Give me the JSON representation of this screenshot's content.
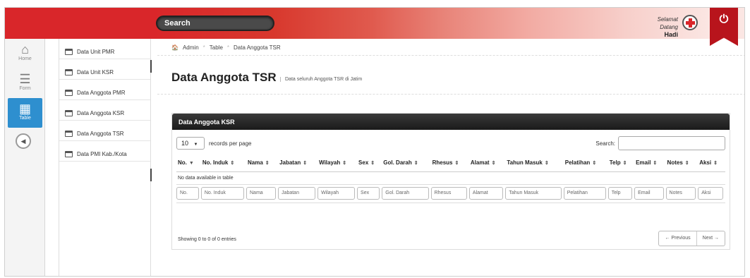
{
  "header": {
    "search_label": "Search",
    "welcome_line1": "Selamat Datang",
    "welcome_user": "Hadi",
    "power_icon": "power-icon",
    "accent_color": "#d9262a"
  },
  "rail": {
    "items": [
      {
        "label": "Home",
        "icon": "home-icon",
        "glyph": "⌂"
      },
      {
        "label": "Form",
        "icon": "list-icon",
        "glyph": "☰"
      },
      {
        "label": "Table",
        "icon": "table-icon",
        "glyph": "▦"
      }
    ],
    "collapse_glyph": "◀"
  },
  "submenu": {
    "items": [
      {
        "label": "Data Unit PMR"
      },
      {
        "label": "Data Unit KSR"
      },
      {
        "label": "Data Anggota PMR"
      },
      {
        "label": "Data Anggota KSR"
      },
      {
        "label": "Data Anggota TSR"
      },
      {
        "label": "Data PMI Kab./Kota"
      }
    ]
  },
  "breadcrumb": {
    "items": [
      "Admin",
      "Table",
      "Data Anggota TSR"
    ],
    "separator": "*"
  },
  "page": {
    "title": "Data Anggota TSR",
    "subtitle": "Data seluruh Anggota TSR di Jatim"
  },
  "table_panel": {
    "heading": "Data Anggota KSR",
    "page_length": "10",
    "page_length_caret": "▼",
    "records_per_page": "records per page",
    "search_label": "Search:",
    "columns": [
      "No.",
      "No. Induk",
      "Nama",
      "Jabatan",
      "Wilayah",
      "Sex",
      "Gol. Darah",
      "Rhesus",
      "Alamat",
      "Tahun Masuk",
      "Pelatihan",
      "Telp",
      "Email",
      "Notes",
      "Aksi"
    ],
    "first_sort": "▼",
    "sort_glyph": "⇕",
    "empty_message": "No data available in table",
    "filters": [
      "No.",
      "No. Induk",
      "Nama",
      "Jabatan",
      "Wilayah",
      "Sex",
      "Gol. Darah",
      "Rhesus",
      "Alamat",
      "Tahun Masuk",
      "Pelatihan",
      "Telp",
      "Email",
      "Notes",
      "Aksi"
    ],
    "info": "Showing 0 to 0 of 0 entries",
    "prev_label": "← Previous",
    "next_label": "Next →"
  }
}
